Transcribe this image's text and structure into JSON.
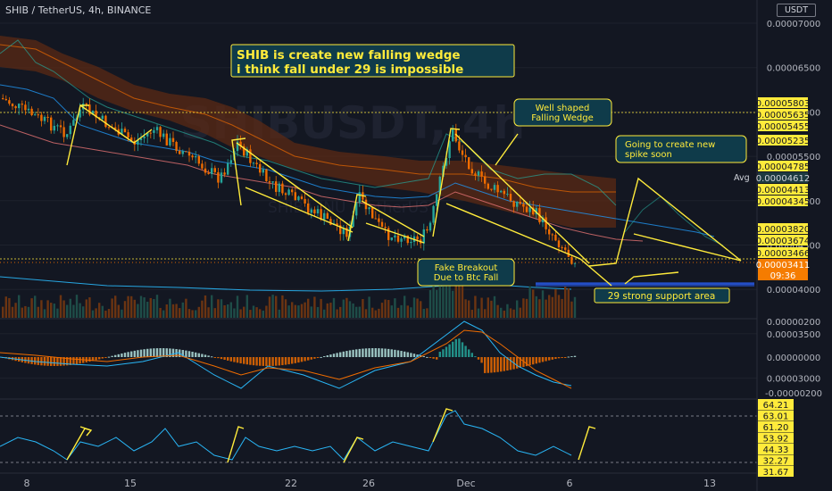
{
  "header": {
    "symbol_title": "SHIB / TetherUS, 4h, BINANCE",
    "currency_button": "USDT",
    "watermark_symbol": "SHIBUSDT, 4h",
    "watermark_name": "SHIBA INU / TetherUS"
  },
  "price_axis": {
    "labels": [
      "0.00007000",
      "0.00006500",
      "0.00006000",
      "0.00005500",
      "0.00005000",
      "0.00004500",
      "0.00004000",
      "0.00003500",
      "0.00003000"
    ],
    "tags": [
      {
        "text": "0.00005803",
        "kind": "yellow"
      },
      {
        "text": "0.00005635",
        "kind": "yellow"
      },
      {
        "text": "0.00005455",
        "kind": "yellow"
      },
      {
        "text": "0.00005235",
        "kind": "yellow"
      },
      {
        "text": "0.00004785",
        "kind": "yellow"
      },
      {
        "text": "0.00004612",
        "kind": "dark"
      },
      {
        "text": "0.00004413",
        "kind": "yellow"
      },
      {
        "text": "0.00004345",
        "kind": "yellow"
      },
      {
        "text": "0.00003820",
        "kind": "yellow"
      },
      {
        "text": "0.00003674",
        "kind": "yellow"
      },
      {
        "text": "0.00003466",
        "kind": "yellow"
      },
      {
        "text": "0.00003411",
        "kind": "orange"
      },
      {
        "text": "09:36",
        "kind": "orange"
      }
    ],
    "avg_label": "Avg"
  },
  "macd_axis": {
    "labels": [
      "0.00000200",
      "0.00000000",
      "-0.00000200"
    ]
  },
  "rsi_axis": {
    "tags": [
      "64.21",
      "63.01",
      "61.20",
      "53.92",
      "44.33",
      "32.27",
      "31.67"
    ]
  },
  "time_axis": {
    "labels": [
      "8",
      "15",
      "22",
      "26",
      "Dec",
      "6",
      "13"
    ]
  },
  "annotations": {
    "title_note_line1": "SHIB is create new falling wedge",
    "title_note_line2": "i think fall under 29 is impossible",
    "wedge_note_line1": "Well shaped",
    "wedge_note_line2": "Falling Wedge",
    "spike_note_line1": "Going to create new",
    "spike_note_line2": "spike soon",
    "breakout_note_line1": "Fake Breakout",
    "breakout_note_line2": "Due to Btc Fall",
    "support_note": "29 strong support area"
  },
  "colors": {
    "background": "#131722",
    "up_candle": "#26a69a",
    "down_candle": "#ef6c00",
    "annotation_yellow": "#ffeb3b",
    "cloud": "#7a3b1a",
    "support_zone": "#2962ff"
  },
  "chart_data": {
    "type": "candlestick",
    "x_ticks": [
      "8",
      "15",
      "22",
      "26",
      "Dec",
      "6",
      "13"
    ],
    "ylim": [
      2.9e-05,
      7.2e-05
    ],
    "price_close_path": [
      {
        "x": "8",
        "y": 5.7e-05
      },
      {
        "x": "11",
        "y": 5.15e-05
      },
      {
        "x": "13",
        "y": 5.35e-05
      },
      {
        "x": "15",
        "y": 5.2e-05
      },
      {
        "x": "17",
        "y": 5.3e-05
      },
      {
        "x": "19",
        "y": 4.4e-05
      },
      {
        "x": "20",
        "y": 5.1e-05
      },
      {
        "x": "22",
        "y": 4.3e-05
      },
      {
        "x": "24",
        "y": 3.8e-05
      },
      {
        "x": "25",
        "y": 4.35e-05
      },
      {
        "x": "26",
        "y": 3.85e-05
      },
      {
        "x": "27",
        "y": 3.95e-05
      },
      {
        "x": "28",
        "y": 5.6e-05
      },
      {
        "x": "29",
        "y": 4.7e-05
      },
      {
        "x": "Dec",
        "y": 4.6e-05
      },
      {
        "x": "3",
        "y": 4.3e-05
      },
      {
        "x": "4",
        "y": 3.8e-05
      },
      {
        "x": "6",
        "y": 3.411e-05
      }
    ],
    "last_price": 3.411e-05,
    "support_level": 3e-05,
    "macd_range": [
      -2e-06,
      2e-06
    ],
    "rsi_levels": [
      64.21,
      63.01,
      61.2,
      53.92,
      44.33,
      32.27,
      31.67
    ]
  }
}
